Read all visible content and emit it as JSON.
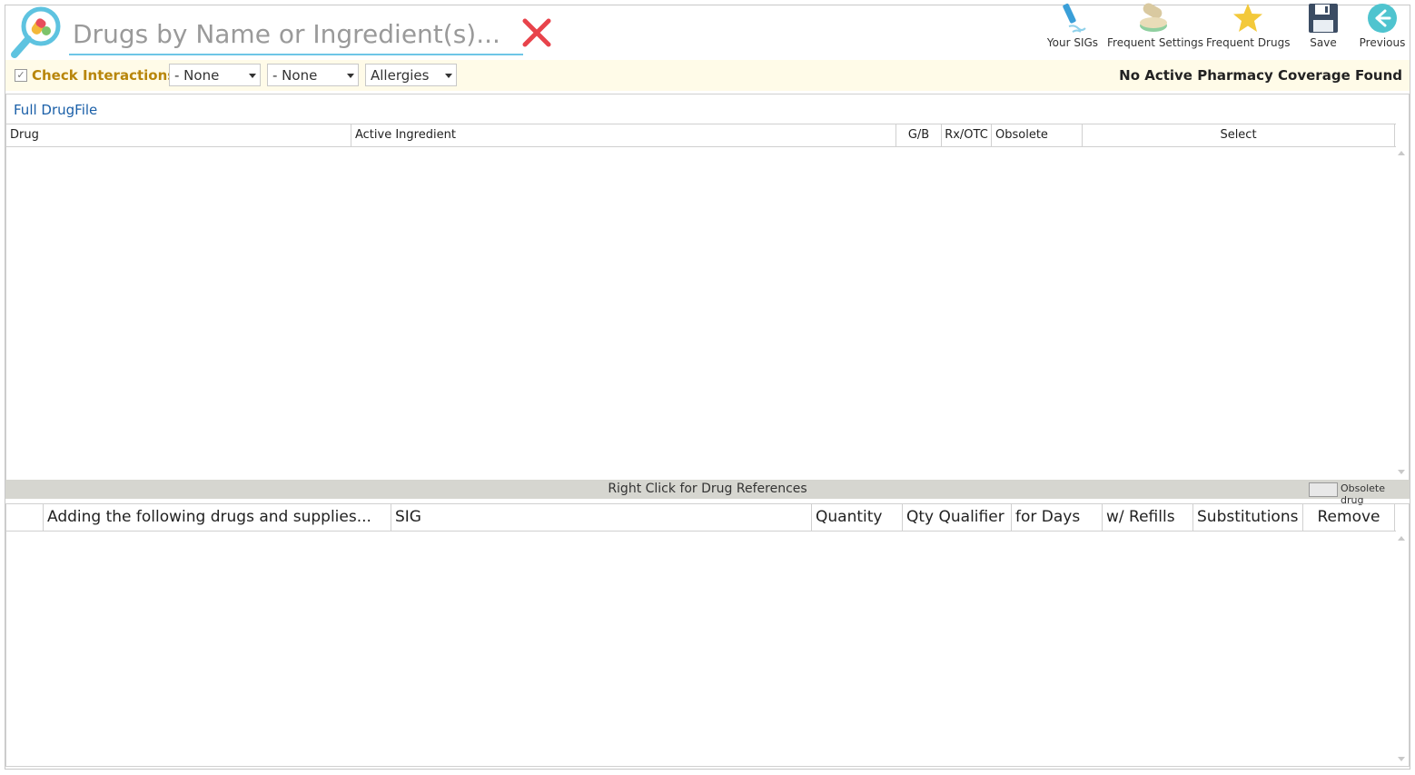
{
  "search": {
    "placeholder": "Drugs by Name or Ingredient(s)..."
  },
  "toolbar": {
    "your_sigs": "Your SIGs",
    "frequent_settings": "Frequent Settings",
    "frequent_drugs": "Frequent Drugs",
    "save": "Save",
    "previous": "Previous"
  },
  "interactions": {
    "checked": true,
    "label": "Check Interactions:",
    "select1": "- None",
    "select2": "- None",
    "select3": "Allergies",
    "coverage": "No Active Pharmacy Coverage Found"
  },
  "drug_grid": {
    "link": "Full DrugFile",
    "columns": [
      "Drug",
      "Active Ingredient",
      "G/B",
      "Rx/OTC",
      "Obsolete",
      "Select"
    ],
    "rows": []
  },
  "statusbar": {
    "hint": "Right Click for Drug References",
    "legend": "Obsolete drug"
  },
  "add_grid": {
    "columns": [
      "",
      "Adding the following drugs and supplies...",
      "SIG",
      "Quantity",
      "Qty Qualifier",
      "for Days",
      "w/ Refills",
      "Substitutions",
      "Remove"
    ],
    "rows": []
  },
  "colors": {
    "accent": "#6ec6e6",
    "label_gold": "#b8860b",
    "link_blue": "#1a5fa8",
    "clear_red": "#e8434b"
  }
}
